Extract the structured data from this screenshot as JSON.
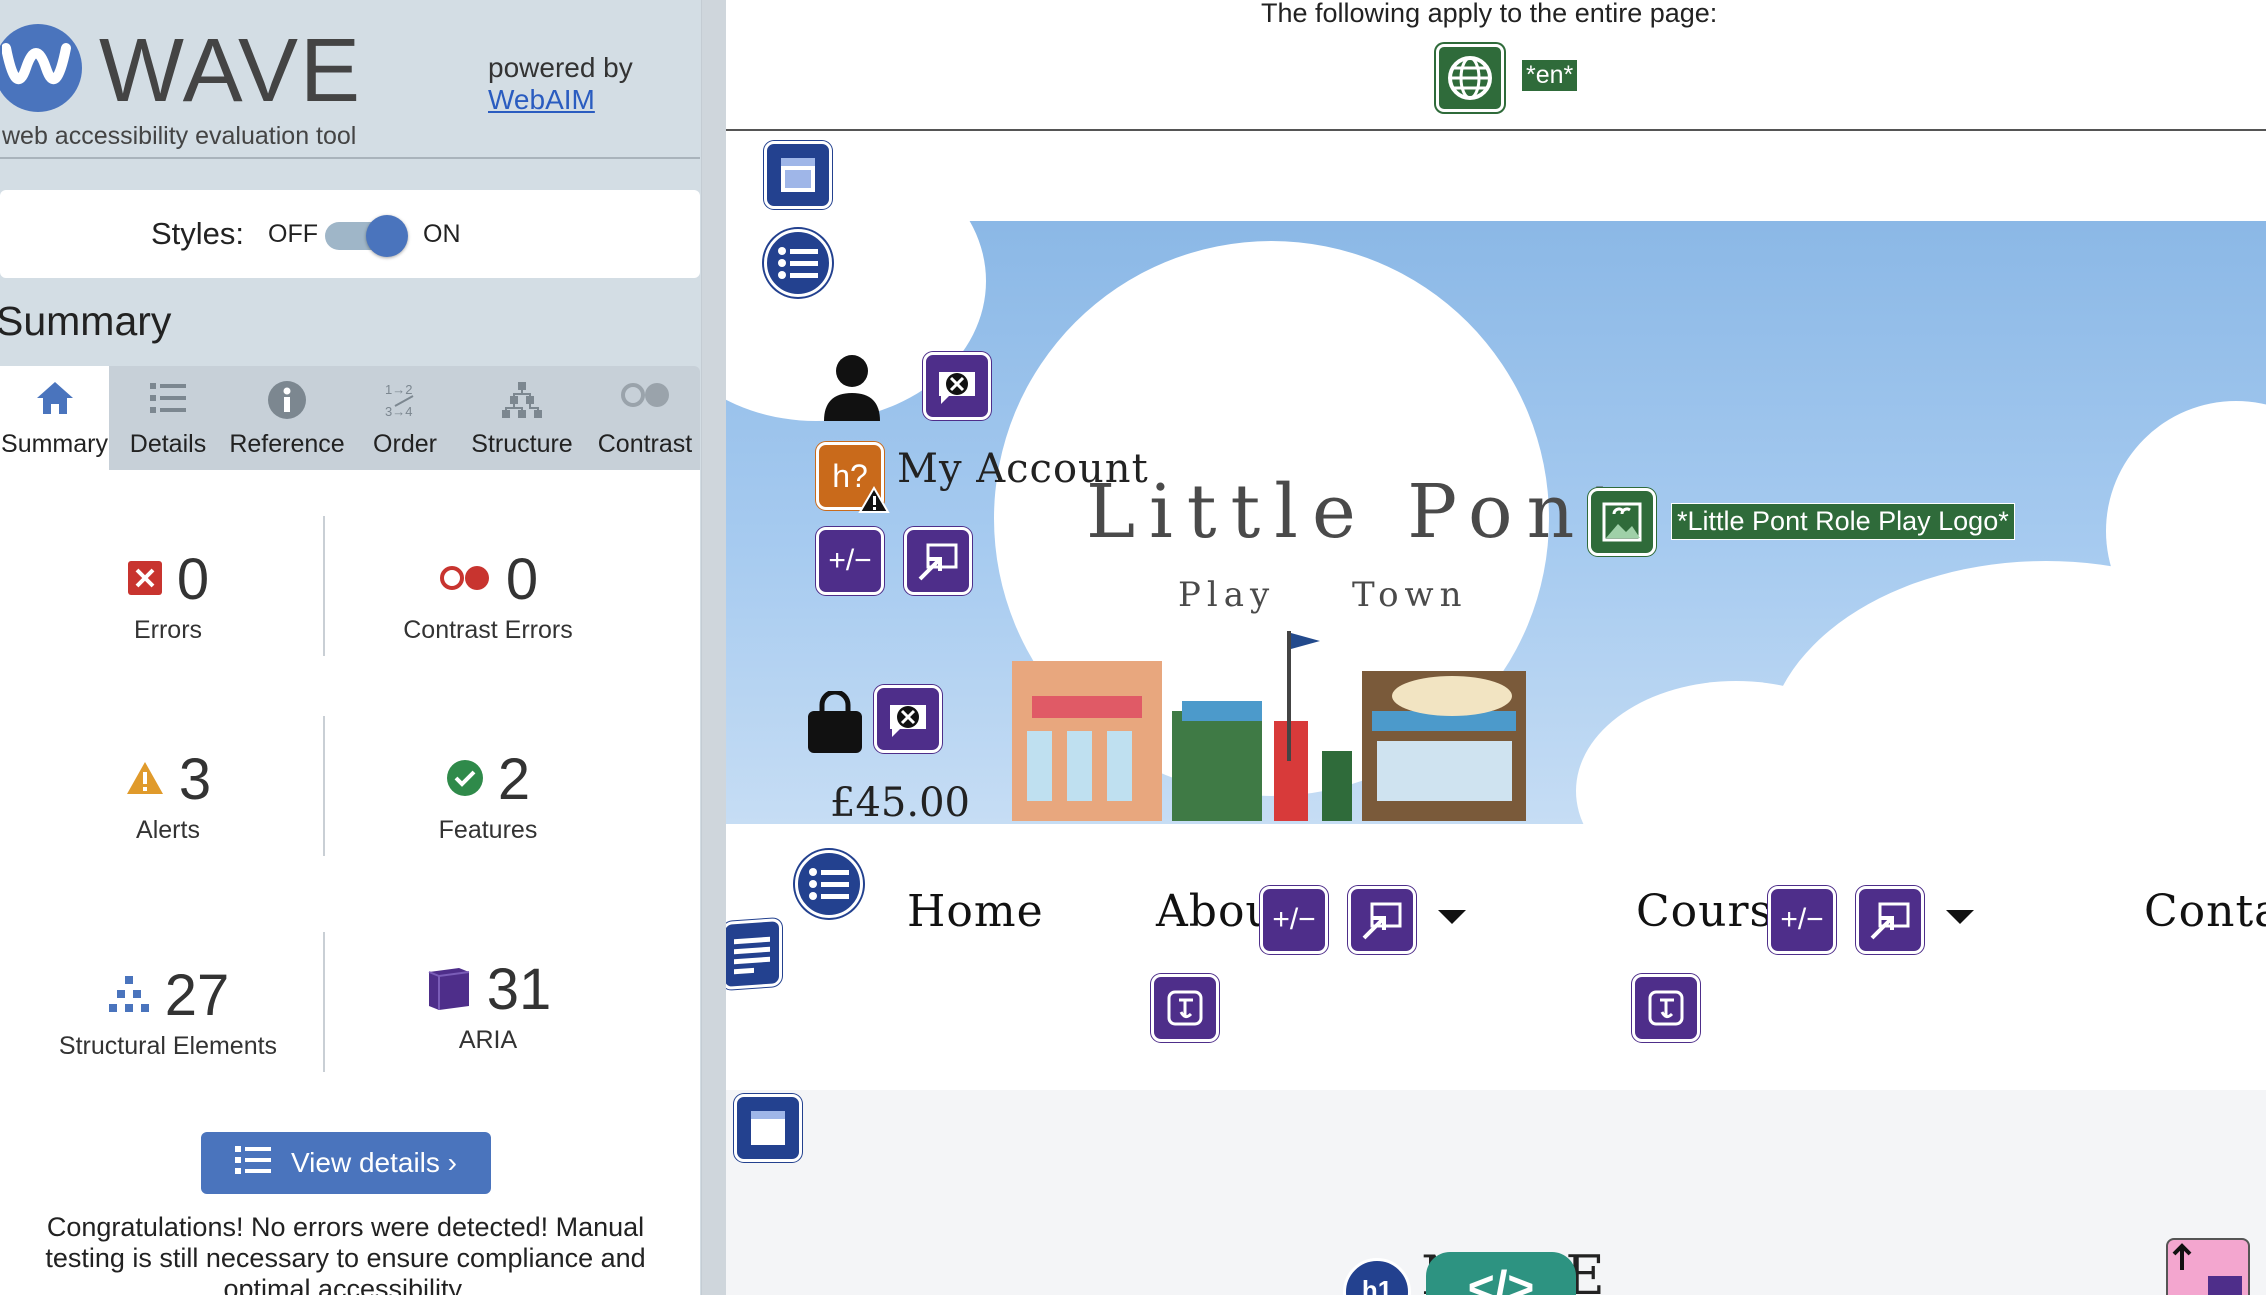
{
  "sidebar": {
    "logo_text": "WAVE",
    "logo_subtitle": "web accessibility evaluation tool",
    "powered_by": "powered by",
    "powered_link": "WebAIM",
    "styles_label": "Styles:",
    "toggle_off": "OFF",
    "toggle_on": "ON",
    "summary_heading": "Summary",
    "tabs": [
      {
        "label": "Summary",
        "icon": "home-icon"
      },
      {
        "label": "Details",
        "icon": "list-icon"
      },
      {
        "label": "Reference",
        "icon": "info-icon"
      },
      {
        "label": "Order",
        "icon": "order-icon"
      },
      {
        "label": "Structure",
        "icon": "structure-icon"
      },
      {
        "label": "Contrast",
        "icon": "contrast-icon"
      }
    ],
    "stats": {
      "errors": {
        "value": "0",
        "label": "Errors"
      },
      "contrast_errors": {
        "value": "0",
        "label": "Contrast Errors"
      },
      "alerts": {
        "value": "3",
        "label": "Alerts"
      },
      "features": {
        "value": "2",
        "label": "Features"
      },
      "structural": {
        "value": "27",
        "label": "Structural Elements"
      },
      "aria": {
        "value": "31",
        "label": "ARIA"
      }
    },
    "view_details": "View details ›",
    "congrats": "Congratulations! No errors were detected! Manual testing is still necessary to ensure compliance and optimal accessibility."
  },
  "preview": {
    "apply_text": "The following apply to the entire page:",
    "lang_tag": "*en*",
    "brand_title": "Little Pont",
    "brand_sub": "Play Town",
    "account_text": "My Account",
    "price": "£45.00",
    "logo_alt": "*Little Pont Role Play Logo*",
    "nav": {
      "home": "Home",
      "about": "About",
      "courses": "Courses",
      "contact": "Contact"
    },
    "h1_icon_text": "h1",
    "code_icon_text": "</>",
    "h1_partial": "M      TLE"
  },
  "colors": {
    "wave_blue": "#4a74bd",
    "aria_purple": "#4e2e8a",
    "structure_blue": "#23418f",
    "feature_green": "#2f6b3a",
    "alert_orange": "#c96a1b",
    "error_red": "#c8342f"
  }
}
